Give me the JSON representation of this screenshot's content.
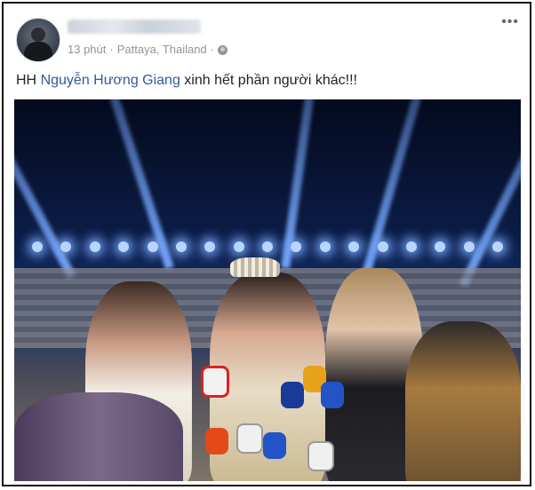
{
  "post": {
    "author_name": "",
    "timestamp": "13 phút",
    "separator": "·",
    "location": "Pattaya, Thailand",
    "audience_icon": "globe-icon",
    "more_icon": "more-options-icon",
    "more_label": "•••"
  },
  "caption": {
    "prefix": "HH ",
    "tagged_name": "Nguyễn Hương Giang",
    "suffix": " xinh hết phần người khác!!!"
  },
  "colors": {
    "link": "#365899",
    "meta": "#90949c",
    "text": "#1d2129"
  }
}
